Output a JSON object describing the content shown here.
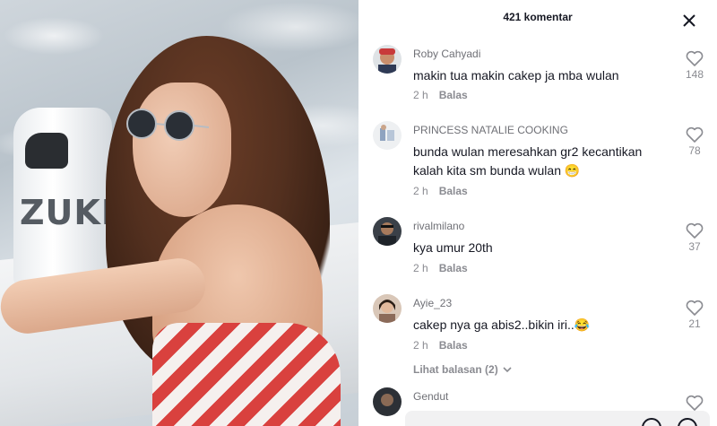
{
  "panel": {
    "comment_count": "421 komentar",
    "close_icon": "close-icon",
    "view_replies": "Lihat balasan (2)"
  },
  "comments": [
    {
      "author": "Roby Cahyadi",
      "text": "makin tua makin cakep ja mba wulan",
      "time": "2 h",
      "reply": "Balas",
      "likes": "148"
    },
    {
      "author": "PRINCESS NATALIE COOKING",
      "text": "bunda wulan meresahkan gr2 kecantikan kalah kita sm bunda wulan 😁",
      "time": "2 h",
      "reply": "Balas",
      "likes": "78"
    },
    {
      "author": "rivalmilano",
      "text": "kya umur 20th",
      "time": "2 h",
      "reply": "Balas",
      "likes": "37"
    },
    {
      "author": "Ayie_23",
      "text": "cakep nya ga abis2..bikin iri..😂",
      "time": "2 h",
      "reply": "Balas",
      "likes": "21"
    },
    {
      "author": "Gendut"
    }
  ],
  "input": {
    "placeholder": ""
  },
  "photo": {
    "motor_text": "ZUKI"
  },
  "colors": {
    "text": "#161823",
    "muted": "#8a8b91",
    "author": "#6f7076"
  }
}
